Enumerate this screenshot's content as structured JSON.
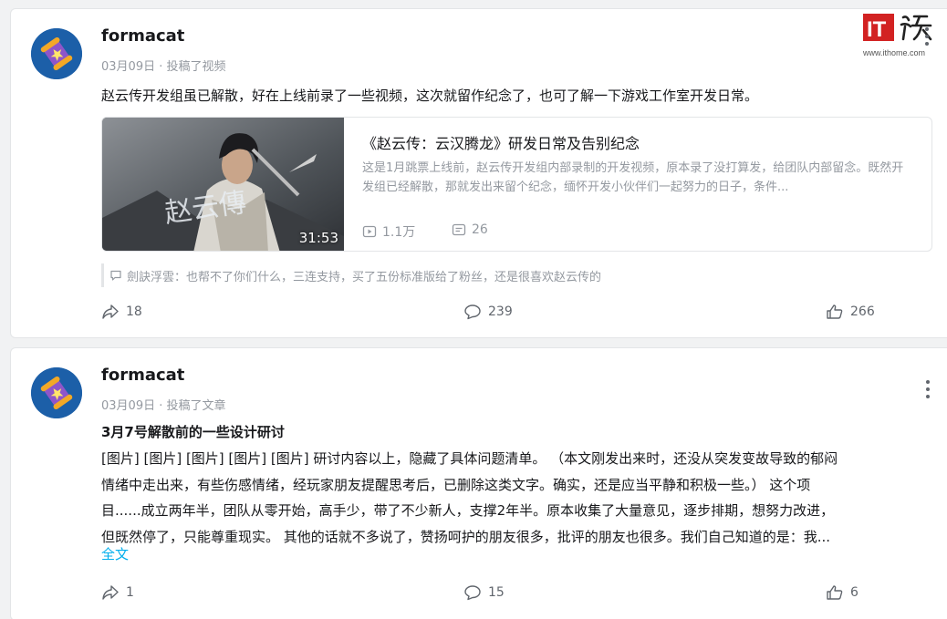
{
  "posts": [
    {
      "author": "formacat",
      "meta": "03月09日 · 投稿了视频",
      "text": "赵云传开发组虽已解散，好在上线前录了一些视频，这次就留作纪念了，也可了解一下游戏工作室开发日常。",
      "video": {
        "title": "《赵云传：云汉腾龙》研发日常及告别纪念",
        "description": "这是1月跳票上线前，赵云传开发组内部录制的开发视频，原本录了没打算发，给团队内部留念。既然开发组已经解散，那就发出来留个纪念，缅怀开发小伙伴们一起努力的日子，条件...",
        "duration": "31:53",
        "plays": "1.1万",
        "danmaku": "26"
      },
      "comment_preview": "劍訣浮雲：也帮不了你们什么，三连支持，买了五份标准版给了粉丝，还是很喜欢赵云传的",
      "actions": {
        "forward": "18",
        "comments": "239",
        "likes": "266"
      }
    },
    {
      "author": "formacat",
      "meta": "03月09日 · 投稿了文章",
      "title": "3月7号解散前的一些设计研讨",
      "body_lines": [
        "[图片] [图片] [图片] [图片] [图片] 研讨内容以上，隐藏了具体问题清单。 （本文刚发出来时，还没从突发变故导致的郁闷",
        "情绪中走出来，有些伤感情绪，经玩家朋友提醒思考后，已删除这类文字。确实，还是应当平静和积极一些。） 这个项",
        "目......成立两年半，团队从零开始，高手少，带了不少新人，支撑2年半。原本收集了大量意见，逐步排期，想努力改进，",
        "但既然停了，只能尊重现实。 其他的话就不多说了，赞扬呵护的朋友很多，批评的朋友也很多。我们自己知道的是：我..."
      ],
      "expand_label": "全文",
      "actions": {
        "forward": "1",
        "comments": "15",
        "likes": "6"
      }
    }
  ],
  "watermark": {
    "logo_text": "IT之家",
    "url": "www.ithome.com"
  },
  "colors": {
    "link": "#00aeec",
    "muted": "#9499a0",
    "text": "#18191c",
    "watermark_red": "#d22222"
  }
}
